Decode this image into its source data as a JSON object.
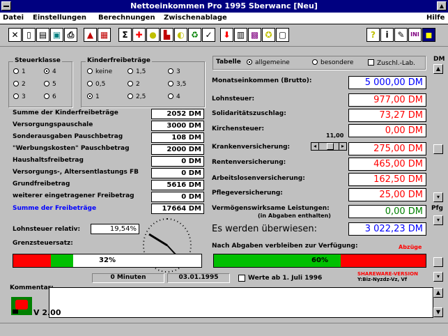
{
  "window": {
    "title": "Nettoeinkommen Pro 1995  Sberwanc  [Neu]",
    "help_label": "Hilfe"
  },
  "menu": {
    "datei": "Datei",
    "einstellungen": "Einstellungen",
    "berechnungen": "Berechnungen",
    "zwischenablage": "Zwischenablage"
  },
  "steuerklasse": {
    "title": "Steuerklasse",
    "options": [
      "1",
      "2",
      "3",
      "4",
      "5",
      "6"
    ],
    "selected": "4"
  },
  "kinder": {
    "title": "Kinderfreibeträge",
    "options": [
      "keine",
      "1,5",
      "3",
      "0,5",
      "2",
      "3,5",
      "1",
      "2,5",
      "4"
    ],
    "selected": "1"
  },
  "tabelle": {
    "label": "Tabelle",
    "allgemeine": "allgemeine",
    "besondere": "besondere",
    "zuschlag": "Zuschl.-Lab."
  },
  "dm_label": "DM",
  "pfg_label": "Pfg",
  "left_rows": [
    {
      "label": "Summe der Kinderfreibeträge",
      "value": "2052 DM"
    },
    {
      "label": "Versorgungspauschale",
      "value": "3000 DM"
    },
    {
      "label": "Sonderausgaben Pauschbetrag",
      "value": "108 DM"
    },
    {
      "label": "\"Werbungskosten\" Pauschbetrag",
      "value": "2000 DM"
    },
    {
      "label": "Haushaltsfreibetrag",
      "value": "0 DM"
    },
    {
      "label": "Versorgungs-, Altersentlastungs FB",
      "value": "0 DM"
    },
    {
      "label": "Grundfreibetrag",
      "value": "5616 DM"
    },
    {
      "label": "weiterer eingetragener Freibetrag",
      "value": "0 DM"
    }
  ],
  "summe": {
    "label": "Summe der Freibeträge",
    "value": "17664 DM"
  },
  "lohnsteuer_relativ": {
    "label": "Lohnsteuer relativ:",
    "value": "19,54%"
  },
  "grenzsteuer_label": "Grenzsteuersatz:",
  "right_rows": [
    {
      "label": "Monatseinkommen (Brutto):",
      "value": "5 000,00 DM"
    },
    {
      "label": "Lohnsteuer:",
      "value": "977,00 DM"
    },
    {
      "label": "Solidaritätszuschlag:",
      "value": "73,27 DM"
    },
    {
      "label": "Kirchensteuer:",
      "value": "0,00 DM"
    },
    {
      "label": "Krankenversicherung:",
      "value": "275,00 DM"
    },
    {
      "label": "Rentenversicherung:",
      "value": "465,00 DM"
    },
    {
      "label": "Arbeitslosenversicherung:",
      "value": "162,50 DM"
    },
    {
      "label": "Pflegeversicherung:",
      "value": "25,00 DM"
    }
  ],
  "vermoegen": {
    "label": "Vermögenswirksame Leistungen:",
    "sublabel": "(in Abgaben enthalten)",
    "value": "0,00 DM"
  },
  "ueberwiesen": {
    "label": "Es werden überwiesen:",
    "value": "3 022,23 DM"
  },
  "nach_abgaben": "Nach Abgaben verbleiben zur Verfügung:",
  "abzuege_label": "Abzüge",
  "kk_slider_label": "11,00",
  "bar_left": {
    "percent": 32,
    "text": "32%",
    "color": "#00c000",
    "rest": "#ff0000"
  },
  "bar_right": {
    "percent": 60,
    "text": "60%",
    "color": "#00c000",
    "rest": "#ff0000"
  },
  "info": {
    "minuten": "0 Minuten",
    "datum": "03.01.1995",
    "werte_label": "Werte ab 1. Juli 1996",
    "sharev": "SHAREWARE-VERSION",
    "sharev2": "Y:Biz-Nyzdz-Vz, Vf"
  },
  "kommentar": {
    "label": "Kommentar:"
  },
  "version": "V 2.00"
}
